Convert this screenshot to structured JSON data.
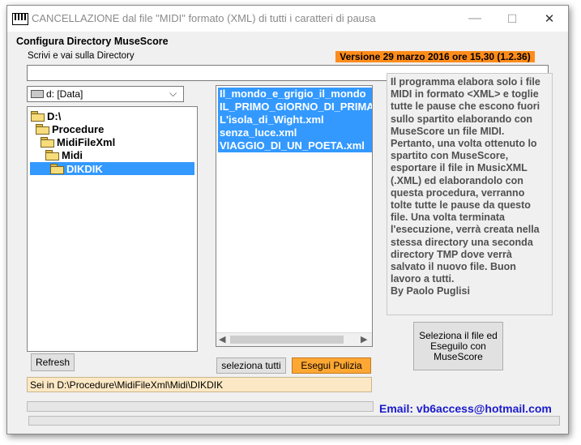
{
  "window": {
    "title": "CANCELLAZIONE dal file \"MIDI\" formato  (XML)  di tutti i caratteri di pausa",
    "controls": {
      "minimize": "—",
      "maximize": "☐",
      "close": "✕"
    }
  },
  "config": {
    "heading": "Configura Directory MuseScore"
  },
  "directory": {
    "label": "Scrivi e vai sulla Directory",
    "value": ""
  },
  "version": {
    "text": "Versione 29 marzo 2016 ore 15,30 (1.2.36)",
    "bg_color": "#ff8c1a"
  },
  "drive": {
    "selected": "d: [Data]"
  },
  "tree": {
    "nodes": [
      {
        "label": "D:\\"
      },
      {
        "label": "Procedure"
      },
      {
        "label": "MidiFileXml"
      },
      {
        "label": "Midi"
      },
      {
        "label": "DIKDIK"
      }
    ]
  },
  "files": [
    "Il_mondo_e_grigio_il_mondo",
    "IL_PRIMO_GIORNO_DI_PRIMAVERA",
    "L'isola_di_Wight.xml",
    "senza_luce.xml",
    "VIAGGIO_DI_UN_POETA.xml"
  ],
  "info": {
    "text": "Il programma elabora solo i file MIDI in formato <XML> e toglie tutte le pause che escono fuori sullo spartito elaborando con MuseScore un file MIDI.\nPertanto, una volta ottenuto lo spartito con MuseScore, esportare il file in MusicXML (.XML) ed elaborandolo con questa procedura, verranno tolte tutte le pause da questo file. Una volta terminata l'esecuzione, verrà creata nella stessa directory una seconda directory TMP dove verrà salvato il nuovo file. Buon lavoro a tutti.\nBy Paolo Puglisi"
  },
  "buttons": {
    "refresh": "Refresh",
    "select_all": "seleziona tutti",
    "execute": "Esegui Pulizia",
    "run_musescore": "Seleziona il file ed Eseguilo con MuseScore"
  },
  "status": {
    "path": "Sei in D:\\Procedure\\MidiFileXml\\Midi\\DIKDIK"
  },
  "email": {
    "text": "Email: vb6access@hotmail.com",
    "color": "#1a1acc"
  },
  "colors": {
    "selection": "#3399ff",
    "execute_button": "#ffa733",
    "status_bg": "#fce8c4"
  }
}
